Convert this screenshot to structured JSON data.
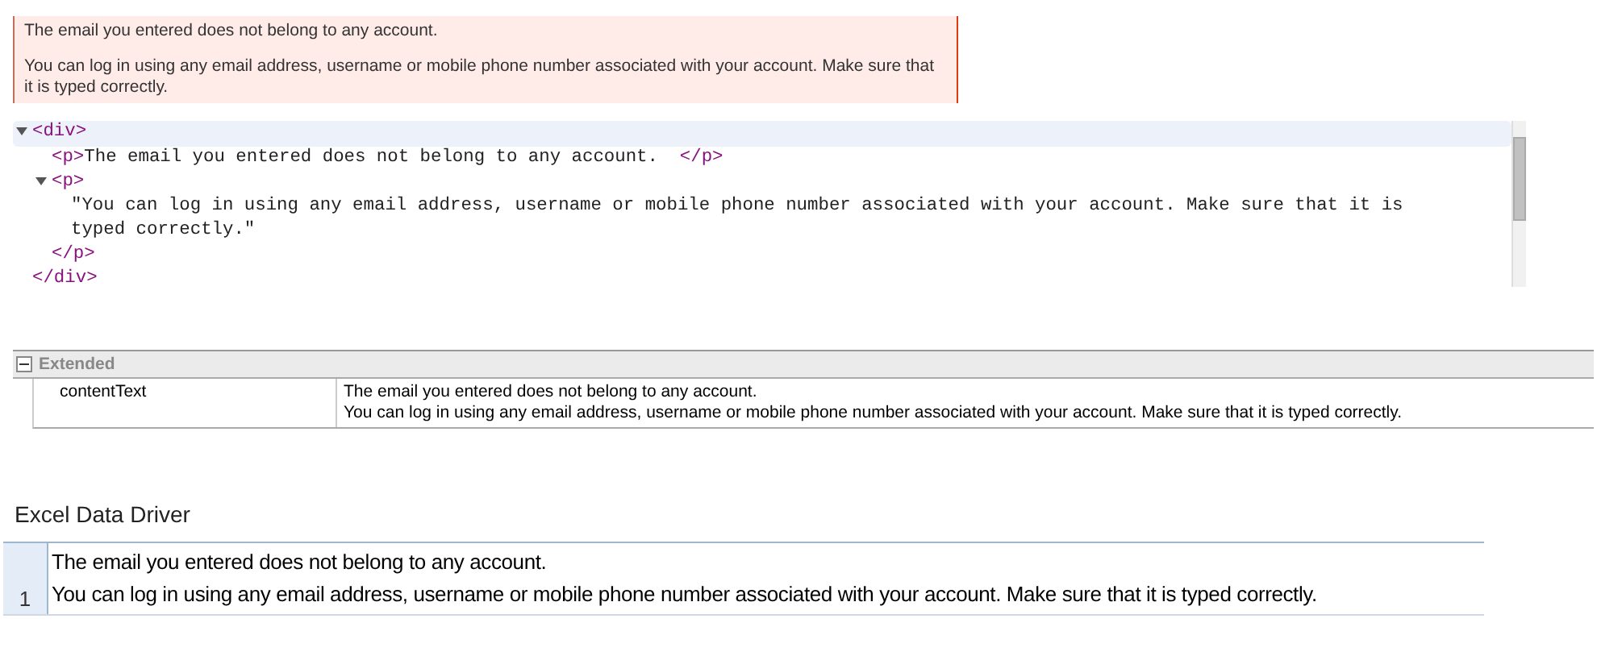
{
  "error_box": {
    "paragraphs": [
      "The email you entered does not belong to any account.",
      "You can log in using any email address, username or mobile phone number associated with your account. Make sure that it is typed correctly."
    ]
  },
  "dom_tree": {
    "nodes": [
      {
        "open": "<div>",
        "expanded": true,
        "selected": true,
        "close": "</div>",
        "children": [
          {
            "open": "<p>",
            "inline_text": "The email you entered does not belong to any account.  ",
            "close": "</p>",
            "selected": false
          },
          {
            "open": "<p>",
            "expanded": true,
            "selected": false,
            "close": "</p>",
            "children": [
              {
                "text": "\"You can log in using any email address, username or mobile phone number associated with your account. Make sure that it is typed correctly.\"",
                "selected": false
              }
            ]
          }
        ]
      }
    ]
  },
  "property_grid": {
    "category": {
      "label": "Extended",
      "expanded": true
    },
    "rows": [
      {
        "name": "contentText",
        "value_lines": [
          "The email you entered does not belong to any account.",
          "You can log in using any email address, username or mobile phone number associated with your account. Make sure that it is typed correctly."
        ]
      }
    ]
  },
  "excel_section": {
    "title": "Excel Data Driver",
    "rows": [
      {
        "number": "1",
        "lines": [
          "The email you entered does not belong to any account.",
          "You can log in using any email address, username or mobile phone number associated with your account. Make sure that it is typed correctly."
        ]
      }
    ]
  }
}
